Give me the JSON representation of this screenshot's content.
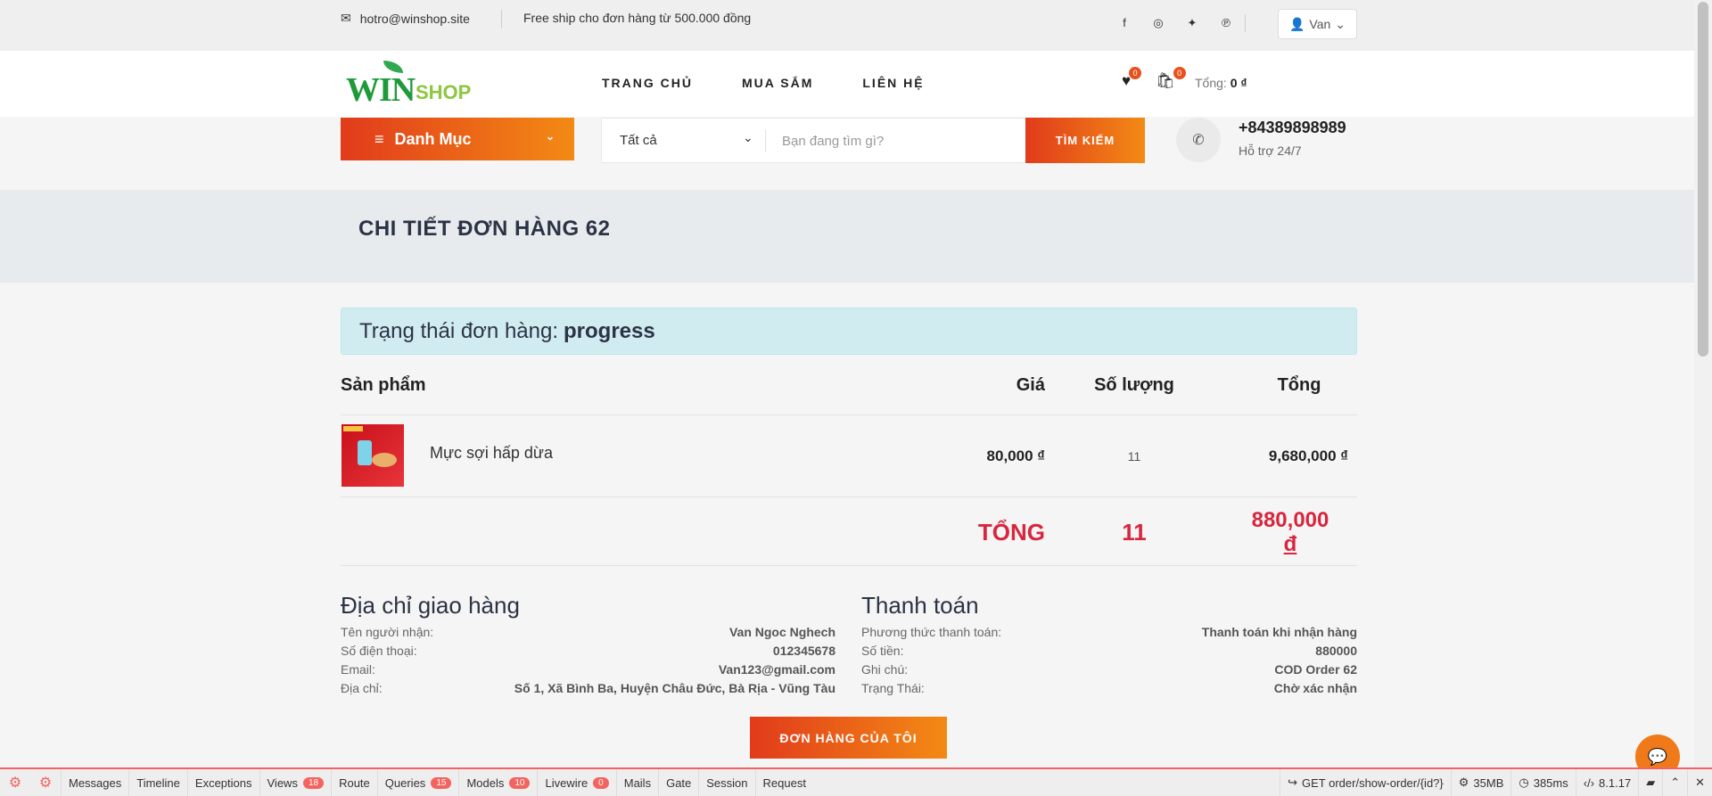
{
  "topbar": {
    "email": "hotro@winshop.site",
    "freeship": "Free ship cho đơn hàng từ 500.000 đồng",
    "user": "Van"
  },
  "header": {
    "logo_win": "WIN",
    "logo_shop": "SHOP",
    "nav": [
      "TRANG CHỦ",
      "MUA SẮM",
      "LIÊN HỆ"
    ],
    "wishlist_count": "0",
    "cart_count": "0",
    "total_label": "Tổng:",
    "total_value": "0 ₫"
  },
  "search": {
    "category_label": "Danh Mục",
    "category_select": "Tất cả",
    "placeholder": "Bạn đang tìm gì?",
    "button": "TÌM KIẾM"
  },
  "support": {
    "phone": "+84389898989",
    "label": "Hỗ trợ 24/7"
  },
  "page": {
    "title": "CHI TIẾT ĐƠN HÀNG 62",
    "status_label": "Trạng thái đơn hàng:",
    "status_value": "progress"
  },
  "order_table": {
    "headers": [
      "Sản phẩm",
      "Giá",
      "Số lượng",
      "Tổng"
    ],
    "items": [
      {
        "name": "Mực sợi hấp dừa",
        "price": "80,000 ₫",
        "qty": "11",
        "total": "9,680,000 ₫"
      }
    ],
    "footer": {
      "label": "TỔNG",
      "qty": "11",
      "total": "880,000",
      "currency": "đ"
    }
  },
  "shipping": {
    "title": "Địa chỉ giao hàng",
    "rows": [
      {
        "k": "Tên người nhận:",
        "v": "Van Ngoc Nghech"
      },
      {
        "k": "Số điện thoại:",
        "v": "012345678"
      },
      {
        "k": "Email:",
        "v": "Van123@gmail.com"
      },
      {
        "k": "Địa chỉ:",
        "v": "Số 1, Xã Bình Ba, Huyện Châu Đức, Bà Rịa - Vũng Tàu"
      }
    ]
  },
  "payment": {
    "title": "Thanh toán",
    "rows": [
      {
        "k": "Phương thức thanh toán:",
        "v": "Thanh toán khi nhận hàng"
      },
      {
        "k": "Số tiền:",
        "v": "880000"
      },
      {
        "k": "Ghi chú:",
        "v": "COD Order 62"
      },
      {
        "k": "Trạng Thái:",
        "v": "Chờ xác nhận"
      }
    ]
  },
  "my_orders_button": "ĐƠN HÀNG CỦA TÔI",
  "debugbar": {
    "tabs": [
      {
        "label": "Messages",
        "count": ""
      },
      {
        "label": "Timeline",
        "count": ""
      },
      {
        "label": "Exceptions",
        "count": ""
      },
      {
        "label": "Views",
        "count": "18"
      },
      {
        "label": "Route",
        "count": ""
      },
      {
        "label": "Queries",
        "count": "15"
      },
      {
        "label": "Models",
        "count": "10"
      },
      {
        "label": "Livewire",
        "count": "0"
      },
      {
        "label": "Mails",
        "count": ""
      },
      {
        "label": "Gate",
        "count": ""
      },
      {
        "label": "Session",
        "count": ""
      },
      {
        "label": "Request",
        "count": ""
      }
    ],
    "route": "GET order/show-order/{id?}",
    "memory": "35MB",
    "time": "385ms",
    "php": "8.1.17"
  },
  "colors": {
    "accent_start": "#e13b1b",
    "accent_end": "#f38a14",
    "total_red": "#d7263d",
    "alert_bg": "#d1ecf1"
  }
}
